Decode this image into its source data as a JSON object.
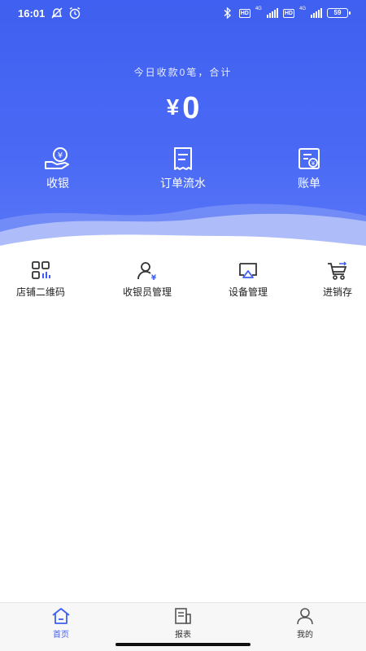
{
  "status_bar": {
    "time": "16:01",
    "left_icons": [
      "no-notification-icon",
      "alarm-icon"
    ],
    "right_icons": [
      "bluetooth-icon",
      "hd-icon",
      "signal-icon",
      "hd-icon",
      "signal-icon",
      "battery-icon"
    ],
    "hd_label": "HD",
    "network_label": "4G",
    "battery": "59"
  },
  "summary": {
    "text": "今日收款0笔，合计",
    "currency": "¥",
    "amount": "0"
  },
  "quick_actions": [
    {
      "label": "收银",
      "icon": "cash-register-icon"
    },
    {
      "label": "订单流水",
      "icon": "order-receipt-icon"
    },
    {
      "label": "账单",
      "icon": "bill-icon"
    }
  ],
  "features": [
    {
      "label": "店铺二维码",
      "icon": "qr-code-icon"
    },
    {
      "label": "收银员管理",
      "icon": "cashier-manage-icon"
    },
    {
      "label": "设备管理",
      "icon": "device-icon"
    },
    {
      "label": "进销存",
      "icon": "cart-icon"
    }
  ],
  "tabbar": {
    "active": "首页",
    "tabs": [
      {
        "label": "首页",
        "icon": "home-icon"
      },
      {
        "label": "报表",
        "icon": "report-icon"
      },
      {
        "label": "我的",
        "icon": "user-icon"
      }
    ]
  },
  "colors": {
    "brand": "#3f5ff0",
    "hero_gradient_end": "#5b78f7",
    "white": "#ffffff"
  }
}
